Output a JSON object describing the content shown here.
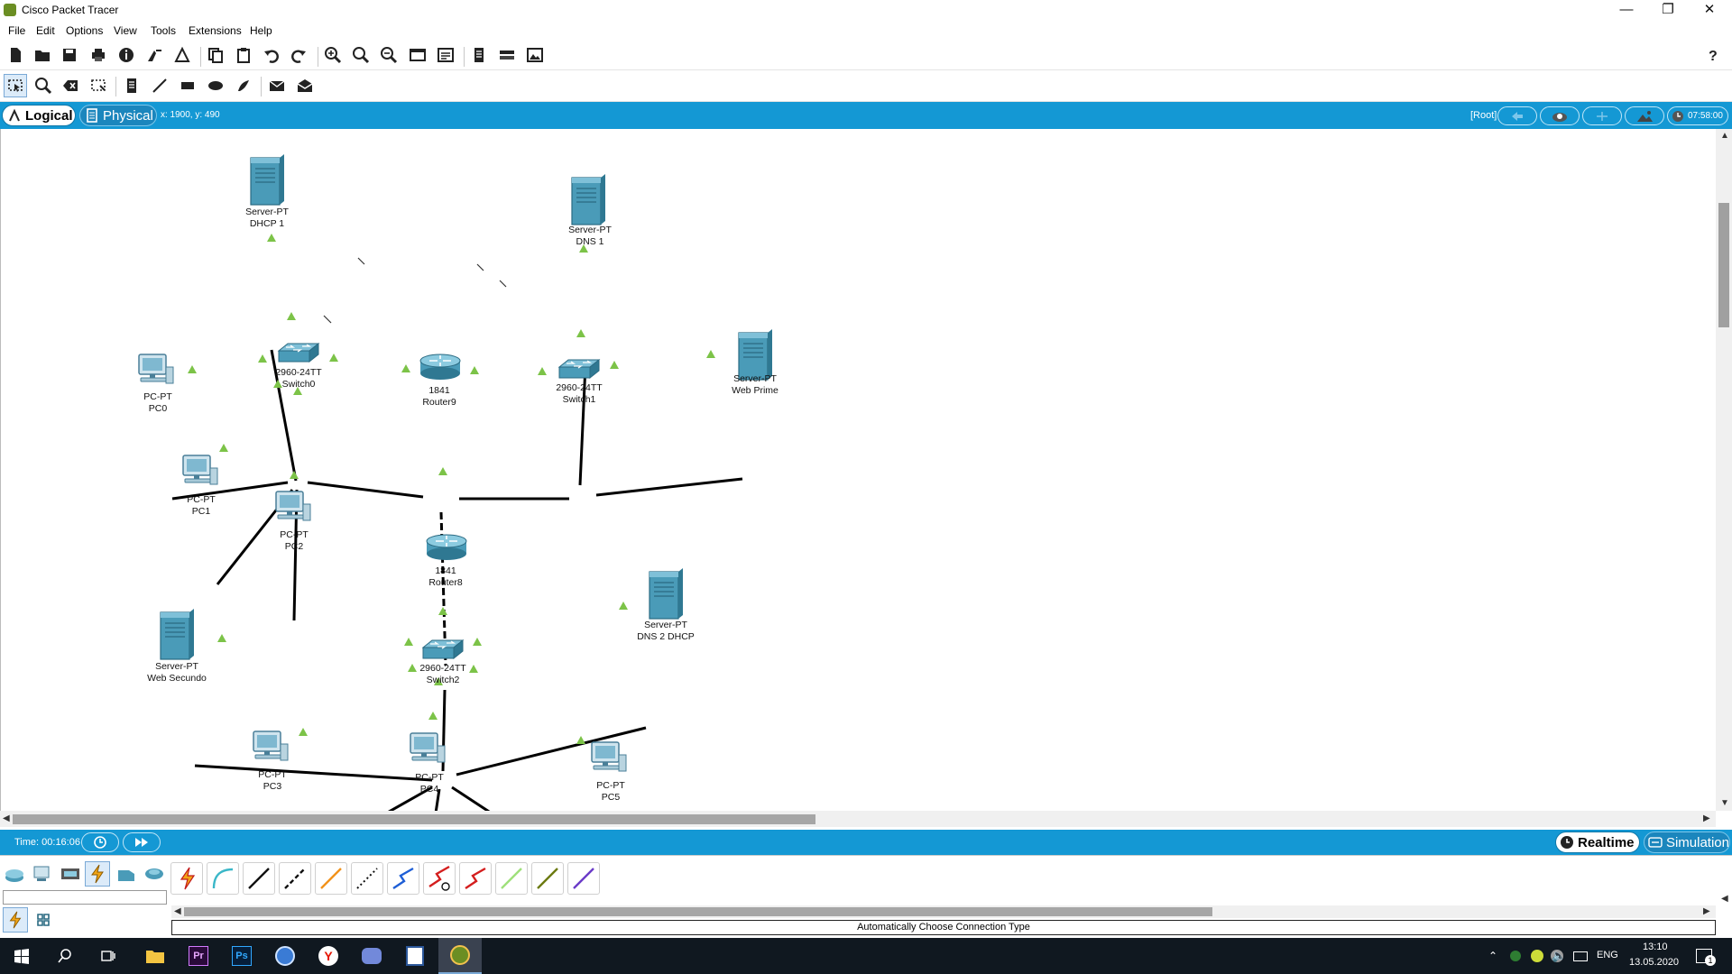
{
  "window": {
    "title": "Cisco Packet Tracer"
  },
  "menu": [
    "File",
    "Edit",
    "Options",
    "View",
    "Tools",
    "Extensions",
    "Help"
  ],
  "icons": {
    "main_toolbar": [
      "new-file-icon",
      "open-folder-icon",
      "save-icon",
      "print-icon",
      "info-icon",
      "activity-wizard-icon",
      "network-info-icon",
      "copy-icon",
      "paste-icon",
      "undo-icon",
      "redo-icon",
      "zoom-in-icon",
      "zoom-reset-icon",
      "zoom-out-icon",
      "drawing-palette-icon",
      "custom-devices-icon",
      "notes-icon",
      "device-panel-icon",
      "viewport-icon",
      "help-icon"
    ],
    "common_toolbar": [
      "select-icon",
      "inspect-icon",
      "delete-icon",
      "resize-icon",
      "place-note-icon",
      "draw-line-icon",
      "draw-rectangle-icon",
      "draw-ellipse-icon",
      "freeform-icon",
      "add-simple-pdu-icon",
      "add-complex-pdu-icon"
    ]
  },
  "modebar": {
    "logical_label": "Logical",
    "physical_label": "Physical",
    "coords": "x: 1900, y: 490",
    "root_label": "[Root]",
    "clock": "07:58:00"
  },
  "devices": [
    {
      "id": "server-dhcp1",
      "model": "Server-PT",
      "name": "DHCP 1"
    },
    {
      "id": "server-dns1",
      "model": "Server-PT",
      "name": "DNS 1"
    },
    {
      "id": "switch0",
      "model": "2960-24TT",
      "name": "Switch0"
    },
    {
      "id": "pc0",
      "model": "PC-PT",
      "name": "PC0"
    },
    {
      "id": "router9",
      "model": "1841",
      "name": "Router9"
    },
    {
      "id": "switch1",
      "model": "2960-24TT",
      "name": "Switch1"
    },
    {
      "id": "server-webprime",
      "model": "Server-PT",
      "name": "Web Prime"
    },
    {
      "id": "pc1",
      "model": "PC-PT",
      "name": "PC1"
    },
    {
      "id": "pc2",
      "model": "PC-PT",
      "name": "PC2"
    },
    {
      "id": "router8",
      "model": "1841",
      "name": "Router8"
    },
    {
      "id": "server-websecundo",
      "model": "Server-PT",
      "name": "Web Secundo"
    },
    {
      "id": "server-dns2dhcp",
      "model": "Server-PT",
      "name": "DNS 2 DHCP"
    },
    {
      "id": "switch2",
      "model": "2960-24TT",
      "name": "Switch2"
    },
    {
      "id": "pc3",
      "model": "PC-PT",
      "name": "PC3"
    },
    {
      "id": "pc4",
      "model": "PC-PT",
      "name": "PC4"
    },
    {
      "id": "pc5",
      "model": "PC-PT",
      "name": "PC5"
    }
  ],
  "timebar": {
    "time": "Time: 00:16:06",
    "realtime_label": "Realtime",
    "simulation_label": "Simulation"
  },
  "devicebar": {
    "connection_description": "Automatically Choose Connection Type",
    "connection_types": [
      "automatic-connection",
      "console",
      "copper-straight-through",
      "copper-cross-over",
      "fiber",
      "phone",
      "coaxial",
      "serial-dce",
      "serial-dte",
      "octal",
      "iot-custom-cable",
      "usb"
    ]
  },
  "taskbar": {
    "language": "ENG",
    "time": "13:10",
    "date": "13.05.2020",
    "notification_count": "1"
  },
  "colors": {
    "mode_bar": "#1498d4",
    "link_up": "#7cc348",
    "device_teal": "#4a9bb8"
  }
}
